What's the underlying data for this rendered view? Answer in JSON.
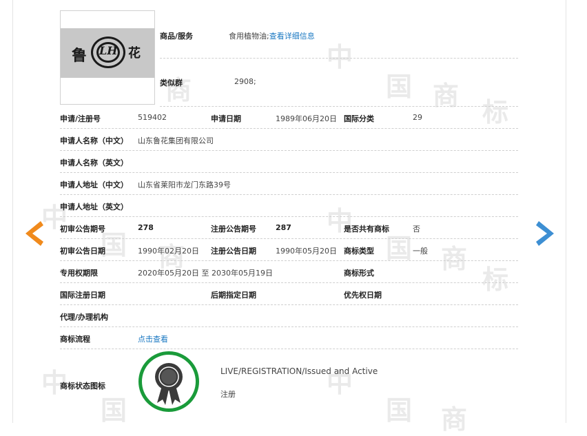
{
  "nav": {
    "prev_icon": "chevron-left-icon",
    "next_icon": "chevron-right-icon",
    "prev_color": "#f08a1c",
    "next_color": "#3d8fd3"
  },
  "logo": {
    "char_left": "鲁",
    "char_mid": "LH",
    "char_right": "花"
  },
  "goods": {
    "label": "商品/服务",
    "value": "食用植物油;",
    "link": "查看详细信息"
  },
  "similar_group": {
    "label": "类似群",
    "value": "2908;"
  },
  "rows": {
    "reg_no": {
      "label": "申请/注册号",
      "value": "519402"
    },
    "apply_date": {
      "label": "申请日期",
      "value": "1989年06月20日"
    },
    "intl_class": {
      "label": "国际分类",
      "value": "29"
    },
    "applicant_cn": {
      "label": "申请人名称（中文）",
      "value": "山东鲁花集团有限公司"
    },
    "applicant_en": {
      "label": "申请人名称（英文）",
      "value": ""
    },
    "address_cn": {
      "label": "申请人地址（中文）",
      "value": "山东省莱阳市龙门东路39号"
    },
    "address_en": {
      "label": "申请人地址（英文）",
      "value": ""
    },
    "prelim_pub_no": {
      "label": "初审公告期号",
      "value": "278"
    },
    "reg_pub_no": {
      "label": "注册公告期号",
      "value": "287"
    },
    "shared": {
      "label": "是否共有商标",
      "value": "否"
    },
    "prelim_pub_date": {
      "label": "初审公告日期",
      "value": "1990年02月20日"
    },
    "reg_pub_date": {
      "label": "注册公告日期",
      "value": "1990年05月20日"
    },
    "mark_type": {
      "label": "商标类型",
      "value": "一般"
    },
    "exclusive_period": {
      "label": "专用权期限",
      "value": "2020年05月20日 至 2030年05月19日"
    },
    "mark_form": {
      "label": "商标形式",
      "value": ""
    },
    "intl_reg_date": {
      "label": "国际注册日期",
      "value": ""
    },
    "later_designation": {
      "label": "后期指定日期",
      "value": ""
    },
    "priority_date": {
      "label": "优先权日期",
      "value": ""
    },
    "agency": {
      "label": "代理/办理机构",
      "value": ""
    },
    "process": {
      "label": "商标流程",
      "link": "点击查看"
    }
  },
  "status": {
    "label": "商标状态图标",
    "icon": "award-ribbon-icon",
    "badge_color": "#1a9b3a",
    "text_en": "LIVE/REGISTRATION/Issued and Active",
    "text_cn": "注册"
  },
  "watermark": {
    "chars": [
      "中",
      "国",
      "商",
      "标"
    ]
  }
}
